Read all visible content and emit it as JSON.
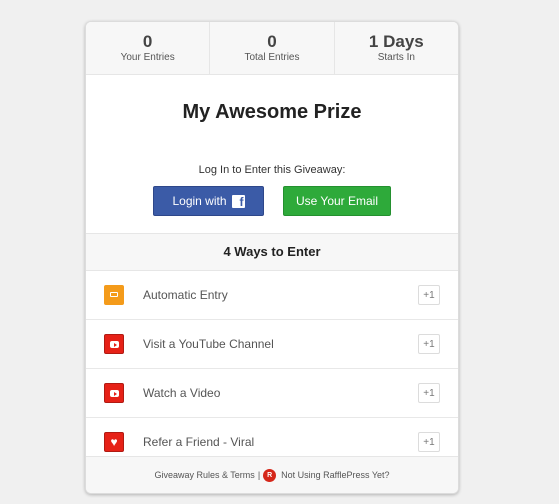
{
  "stats": [
    {
      "value": "0",
      "label": "Your Entries"
    },
    {
      "value": "0",
      "label": "Total Entries"
    },
    {
      "value": "1 Days",
      "label": "Starts In"
    }
  ],
  "prize_title": "My Awesome Prize",
  "login": {
    "prompt": "Log In to Enter this Giveaway:",
    "facebook_label": "Login with",
    "facebook_icon": "facebook-icon",
    "email_label": "Use Your Email"
  },
  "ways_header": "4 Ways to Enter",
  "entries": [
    {
      "icon": "ticket-icon",
      "label": "Automatic Entry",
      "points": "+1",
      "color": "#f49b1a"
    },
    {
      "icon": "youtube-icon",
      "label": "Visit a YouTube Channel",
      "points": "+1",
      "color": "#e62117"
    },
    {
      "icon": "youtube-icon",
      "label": "Watch a Video",
      "points": "+1",
      "color": "#e62117"
    },
    {
      "icon": "heart-icon",
      "label": "Refer a Friend - Viral",
      "points": "+1",
      "color": "#e62117"
    }
  ],
  "footer": {
    "rules_link": "Giveaway Rules & Terms",
    "separator": "|",
    "promo_link": "Not Using RafflePress Yet?"
  },
  "colors": {
    "facebook_button": "#3b5ba7",
    "email_button": "#2eaa3a"
  }
}
